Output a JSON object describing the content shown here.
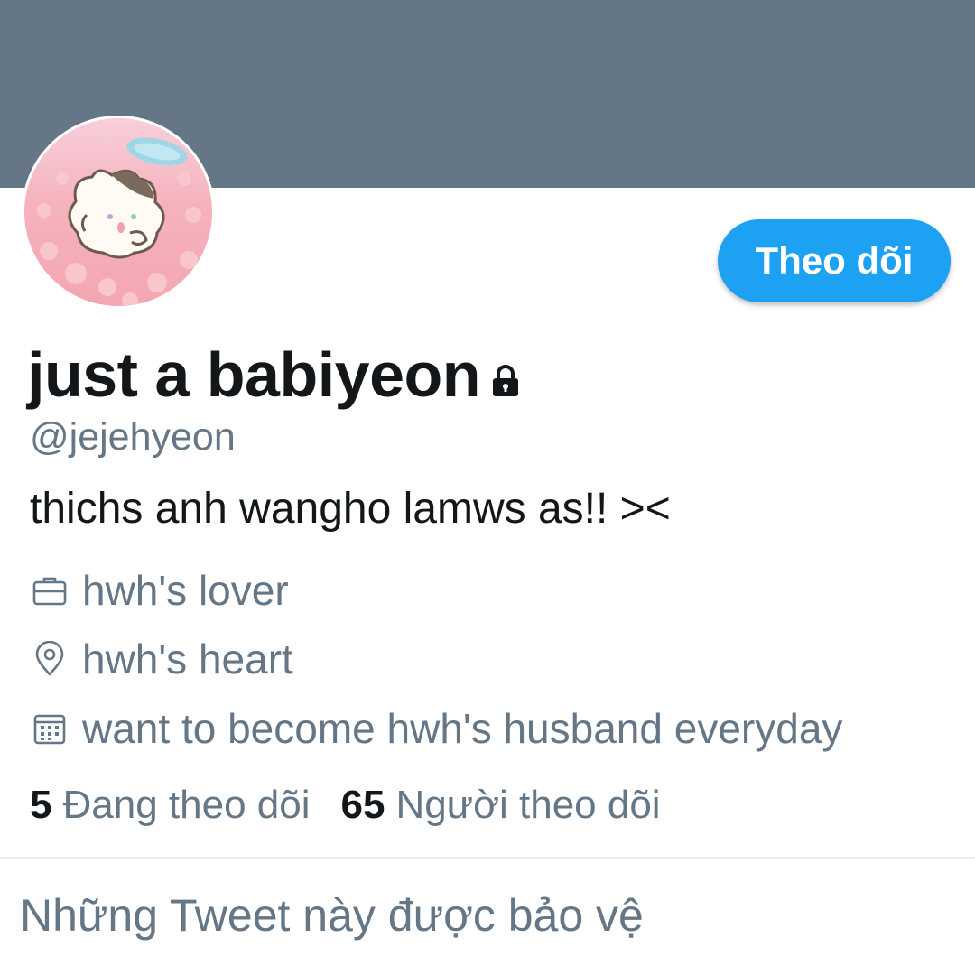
{
  "colors": {
    "banner": "#657786",
    "accent": "#1da1f2",
    "secondary_text": "#657786",
    "primary_text": "#14171a"
  },
  "profile": {
    "display_name": "just a babiyeon",
    "handle": "@jejehyeon",
    "bio": "thichs anh wangho lamws as!! ><",
    "locked_icon": "lock-icon",
    "avatar_icon": "cat-avatar"
  },
  "actions": {
    "follow_label": "Theo dõi"
  },
  "meta": {
    "occupation": {
      "icon": "briefcase-icon",
      "text": "hwh's lover"
    },
    "location": {
      "icon": "location-pin-icon",
      "text": "hwh's heart"
    },
    "joined": {
      "icon": "calendar-icon",
      "text": "want to become hwh's husband everyday"
    }
  },
  "stats": {
    "following": {
      "count": "5",
      "label": "Đang theo dõi"
    },
    "followers": {
      "count": "65",
      "label": "Người theo dõi"
    }
  },
  "protected_notice": "Những Tweet này được bảo vệ"
}
